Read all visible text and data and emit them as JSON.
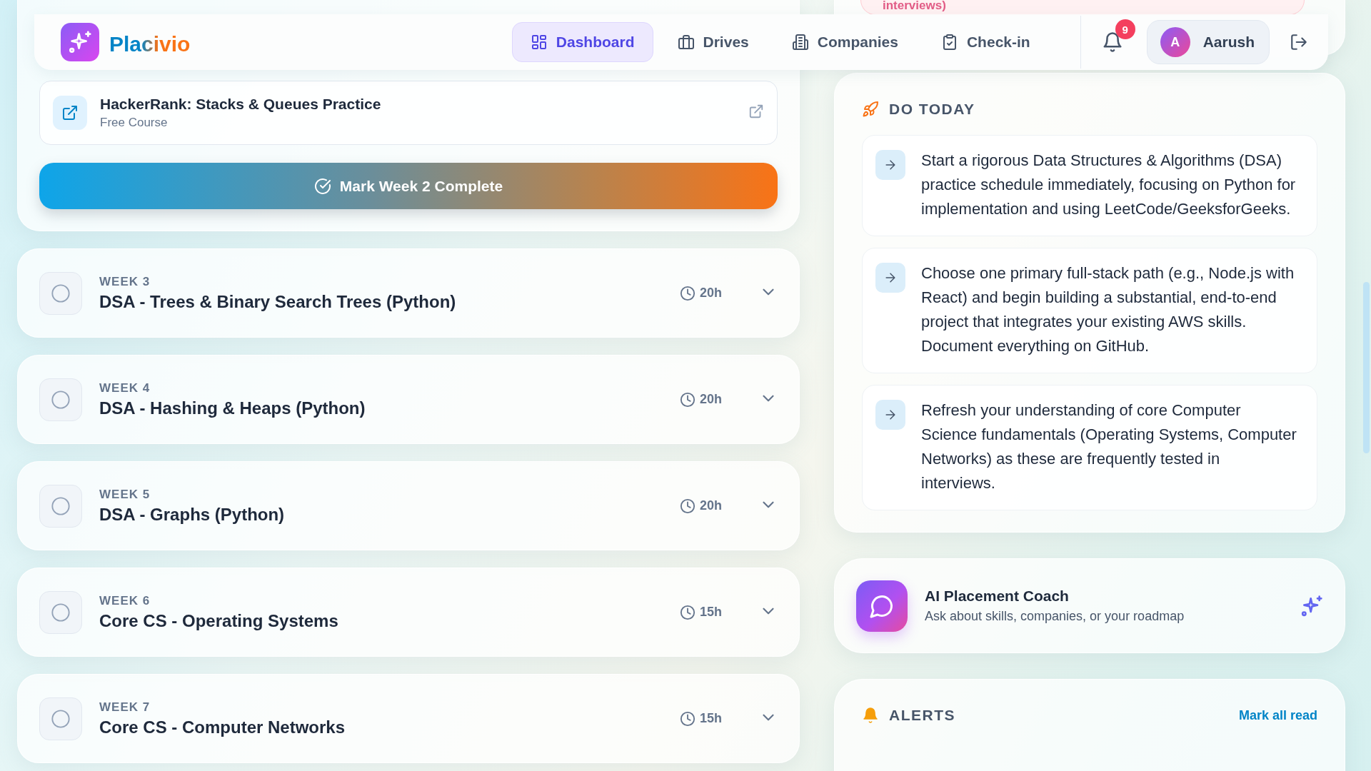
{
  "nav": {
    "logo_text": "Placivio",
    "items": [
      {
        "label": "Dashboard",
        "selected": true
      },
      {
        "label": "Drives",
        "selected": false
      },
      {
        "label": "Companies",
        "selected": false
      },
      {
        "label": "Check-in",
        "selected": false
      }
    ],
    "notification_count": "9",
    "user": {
      "initial": "A",
      "name": "Aarush"
    }
  },
  "current_week": {
    "resources": [
      {
        "title": "HackerRank: Stacks & Queues Practice",
        "source": "Free Course"
      }
    ],
    "complete_button": "Mark Week 2 Complete"
  },
  "weeks": [
    {
      "label": "WEEK 3",
      "title": "DSA - Trees & Binary Search Trees (Python)",
      "hours": "20h",
      "checked": false
    },
    {
      "label": "WEEK 4",
      "title": "DSA - Hashing & Heaps (Python)",
      "hours": "20h",
      "checked": false
    },
    {
      "label": "WEEK 5",
      "title": "DSA - Graphs (Python)",
      "hours": "20h",
      "checked": false
    },
    {
      "label": "WEEK 6",
      "title": "Core CS - Operating Systems",
      "hours": "15h",
      "checked": false
    },
    {
      "label": "WEEK 7",
      "title": "Core CS - Computer Networks",
      "hours": "15h",
      "checked": false
    }
  ],
  "cut_card_text": "interviews)",
  "do_today": {
    "title": "DO TODAY",
    "items": [
      "Start a rigorous Data Structures & Algorithms (DSA) practice schedule immediately, focusing on Python for implementation and using LeetCode/GeeksforGeeks.",
      "Choose one primary full-stack path (e.g., Node.js with React) and begin building a substantial, end-to-end project that integrates your existing AWS skills. Document everything on GitHub.",
      "Refresh your understanding of core Computer Science fundamentals (Operating Systems, Computer Networks) as these are frequently tested in interviews."
    ]
  },
  "coach": {
    "title": "AI Placement Coach",
    "subtitle": "Ask about skills, companies, or your roadmap"
  },
  "alerts": {
    "title": "ALERTS",
    "action": "Mark all read"
  }
}
